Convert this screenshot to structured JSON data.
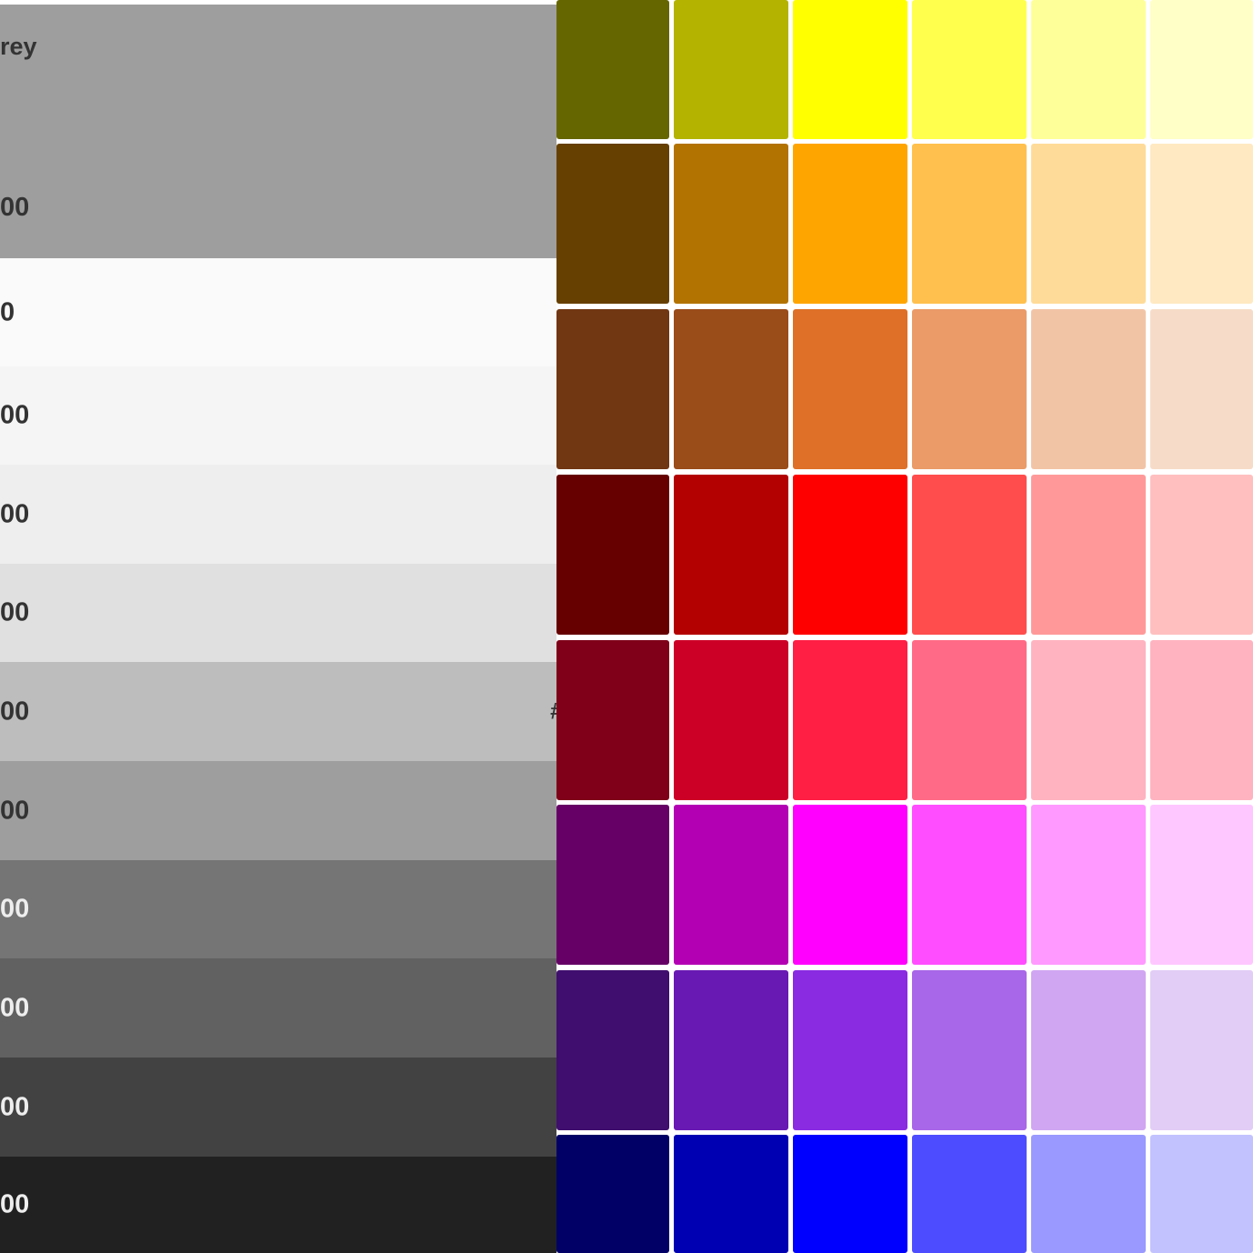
{
  "grey_panel": {
    "title": "rey",
    "header_shade": "00",
    "header_color": "#9e9e9e",
    "rows": [
      {
        "label": "0",
        "hex": "",
        "color": "#fafafa",
        "text_color": "#333333"
      },
      {
        "label": "00",
        "hex": "",
        "color": "#f5f5f5",
        "text_color": "#333333"
      },
      {
        "label": "00",
        "hex": "",
        "color": "#eeeeee",
        "text_color": "#333333"
      },
      {
        "label": "00",
        "hex": "",
        "color": "#e0e0e0",
        "text_color": "#333333"
      },
      {
        "label": "00",
        "hex": "#",
        "color": "#bdbdbd",
        "text_color": "#333333"
      },
      {
        "label": "00",
        "hex": "",
        "color": "#9e9e9e",
        "text_color": "#333333"
      },
      {
        "label": "00",
        "hex": "",
        "color": "#757575",
        "text_color": "#eeeeee"
      },
      {
        "label": "00",
        "hex": "",
        "color": "#616161",
        "text_color": "#eeeeee"
      },
      {
        "label": "00",
        "hex": "",
        "color": "#424242",
        "text_color": "#eeeeee"
      },
      {
        "label": "00",
        "hex": "",
        "color": "#212121",
        "text_color": "#eeeeee"
      }
    ]
  },
  "swatch_rows": [
    {
      "name": "yellow",
      "colors": [
        "#666600",
        "#b3b300",
        "#ffff00",
        "#ffff4d",
        "#ffff99",
        "#ffffc7"
      ]
    },
    {
      "name": "orange",
      "colors": [
        "#664000",
        "#b37300",
        "#ffa500",
        "#ffc04d",
        "#ffdb99",
        "#ffe9c2"
      ]
    },
    {
      "name": "brown",
      "colors": [
        "#713612",
        "#9a4c19",
        "#de7027",
        "#ea9b68",
        "#f2c4a6",
        "#f6dcc8"
      ]
    },
    {
      "name": "red",
      "colors": [
        "#660000",
        "#b30000",
        "#ff0000",
        "#ff4d4d",
        "#ff9999",
        "#ffbfbf"
      ]
    },
    {
      "name": "crimson",
      "colors": [
        "#7f0018",
        "#cc0027",
        "#ff1f44",
        "#ff6b86",
        "#ffb3c0",
        "#ffb3c0"
      ]
    },
    {
      "name": "magenta",
      "colors": [
        "#660066",
        "#b300b3",
        "#ff00ff",
        "#ff4dff",
        "#ff99ff",
        "#ffc7ff"
      ]
    },
    {
      "name": "purple",
      "colors": [
        "#3f0e6e",
        "#6919b3",
        "#8a2be2",
        "#a866e8",
        "#d0a6f2",
        "#e2cdf6"
      ]
    },
    {
      "name": "blue",
      "colors": [
        "#000066",
        "#0000b3",
        "#0000ff",
        "#4d4dff",
        "#9999ff",
        "#c2c2ff"
      ]
    }
  ]
}
